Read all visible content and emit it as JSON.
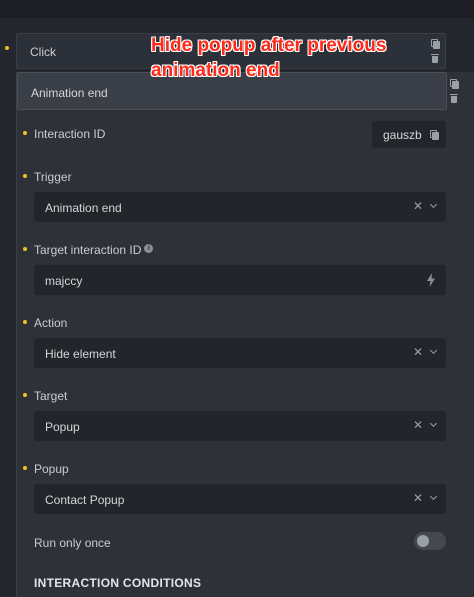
{
  "interactions": {
    "collapsed_item_label": "Click",
    "expanded_item_label": "Animation end"
  },
  "fields": {
    "interaction_id": {
      "label": "Interaction ID",
      "value": "gauszb"
    },
    "trigger": {
      "label": "Trigger",
      "value": "Animation end"
    },
    "target_interaction_id": {
      "label": "Target interaction ID",
      "value": "majccy"
    },
    "action": {
      "label": "Action",
      "value": "Hide element"
    },
    "target": {
      "label": "Target",
      "value": "Popup"
    },
    "popup": {
      "label": "Popup",
      "value": "Contact Popup"
    },
    "run_only_once": {
      "label": "Run only once",
      "enabled": false
    }
  },
  "section": {
    "conditions_title": "INTERACTION CONDITIONS"
  },
  "annotation": {
    "text": "Hide popup after previous animation end"
  },
  "colors": {
    "accent_bullet": "#f0c419",
    "annotation_red": "#ff2a1a",
    "panel_bg": "#2e3238",
    "field_bg": "#22252a"
  },
  "icons": {
    "copy": "copy-icon",
    "delete": "trash-icon",
    "clear": "clear-icon",
    "dropdown": "chevron-down-icon",
    "dynamic_data": "bolt-icon",
    "info": "info-icon"
  }
}
